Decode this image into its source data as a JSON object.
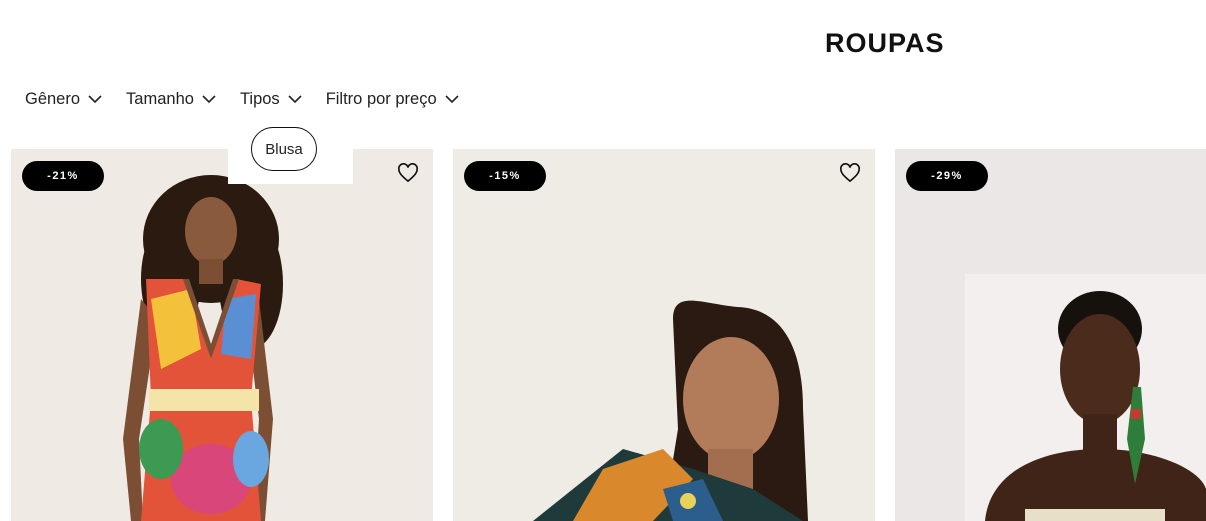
{
  "page": {
    "title": "ROUPAS"
  },
  "filters": [
    {
      "label": "Gênero"
    },
    {
      "label": "Tamanho"
    },
    {
      "label": "Tipos"
    },
    {
      "label": "Filtro por preço"
    }
  ],
  "types_dropdown": {
    "options": [
      "Blusa"
    ]
  },
  "products": [
    {
      "discount": "-21%",
      "wishlist_icon": "heart-icon"
    },
    {
      "discount": "-15%",
      "wishlist_icon": "heart-icon"
    },
    {
      "discount": "-29%",
      "wishlist_icon": "heart-icon"
    }
  ],
  "colors": {
    "badge_bg": "#000000",
    "badge_text": "#ffffff",
    "card_bg": "#efebe5"
  }
}
